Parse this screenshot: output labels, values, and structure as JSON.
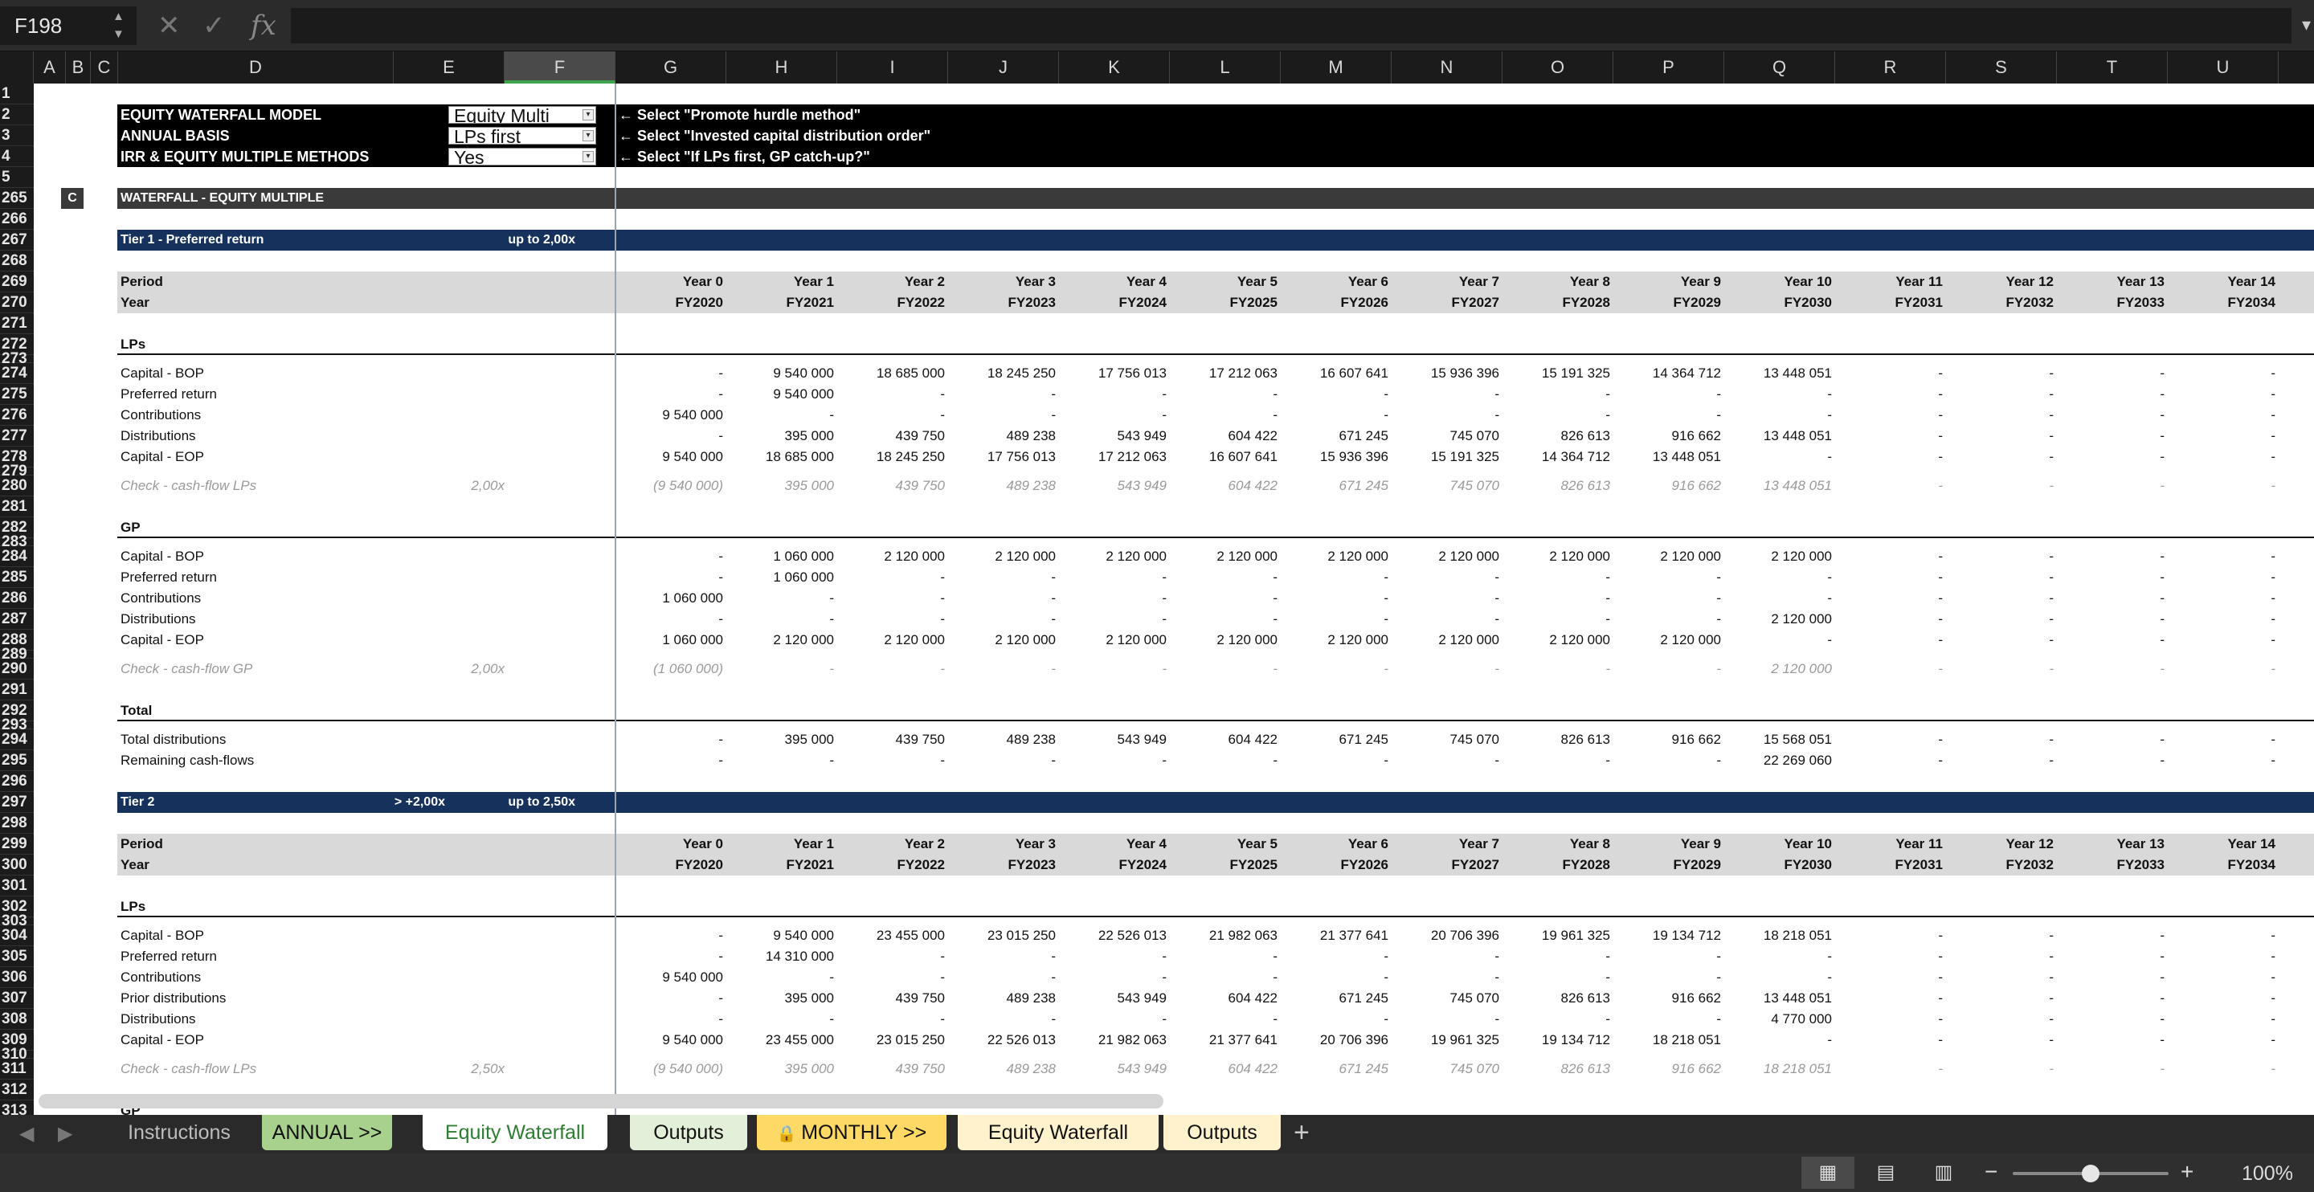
{
  "formula_bar": {
    "name_box": "F198",
    "formula": "",
    "cancel_icon": "close-icon",
    "enter_icon": "checkmark-icon",
    "fx_label": "fx"
  },
  "columns": [
    "A",
    "B",
    "C",
    "D",
    "E",
    "F",
    "G",
    "H",
    "I",
    "J",
    "K",
    "L",
    "M",
    "N",
    "O",
    "P",
    "Q",
    "R",
    "S",
    "T",
    "U"
  ],
  "selected_column": "F",
  "header_block": {
    "r2": {
      "label": "EQUITY WATERFALL MODEL",
      "dropdown": "Equity Multi",
      "note": "← Select \"Promote hurdle method\""
    },
    "r3": {
      "label": "ANNUAL BASIS",
      "dropdown": "LPs first",
      "note": "← Select \"Invested capital distribution order\""
    },
    "r4": {
      "label": "IRR & EQUITY MULTIPLE METHODS",
      "dropdown": "Yes",
      "note": "← Select \"If LPs first, GP catch-up?\""
    }
  },
  "section": {
    "marker": "C",
    "title": "WATERFALL - EQUITY MULTIPLE"
  },
  "tier1": {
    "title": "Tier 1 - Preferred return",
    "hurdle": "up to 2,00x"
  },
  "tier2": {
    "title": "Tier 2",
    "lower": "> +2,00x",
    "hurdle": "up to 2,50x"
  },
  "periods": {
    "period_label": "Period",
    "year_label": "Year",
    "years": [
      "Year 0",
      "Year 1",
      "Year 2",
      "Year 3",
      "Year 4",
      "Year 5",
      "Year 6",
      "Year 7",
      "Year 8",
      "Year 9",
      "Year 10",
      "Year 11",
      "Year 12",
      "Year 13",
      "Year 14"
    ],
    "fiscal": [
      "FY2020",
      "FY2021",
      "FY2022",
      "FY2023",
      "FY2024",
      "FY2025",
      "FY2026",
      "FY2027",
      "FY2028",
      "FY2029",
      "FY2030",
      "FY2031",
      "FY2032",
      "FY2033",
      "FY2034"
    ]
  },
  "t1_lps": {
    "heading": "LPs",
    "rows": [
      {
        "label": "Capital - BOP",
        "values": [
          "-",
          "9 540 000",
          "18 685 000",
          "18 245 250",
          "17 756 013",
          "17 212 063",
          "16 607 641",
          "15 936 396",
          "15 191 325",
          "14 364 712",
          "13 448 051",
          "-",
          "-",
          "-",
          "-"
        ]
      },
      {
        "label": "Preferred return",
        "values": [
          "-",
          "9 540 000",
          "-",
          "-",
          "-",
          "-",
          "-",
          "-",
          "-",
          "-",
          "-",
          "-",
          "-",
          "-",
          "-"
        ]
      },
      {
        "label": "Contributions",
        "values": [
          "9 540 000",
          "-",
          "-",
          "-",
          "-",
          "-",
          "-",
          "-",
          "-",
          "-",
          "-",
          "-",
          "-",
          "-",
          "-"
        ]
      },
      {
        "label": "Distributions",
        "values": [
          "-",
          "395 000",
          "439 750",
          "489 238",
          "543 949",
          "604 422",
          "671 245",
          "745 070",
          "826 613",
          "916 662",
          "13 448 051",
          "-",
          "-",
          "-",
          "-"
        ]
      },
      {
        "label": "Capital - EOP",
        "values": [
          "9 540 000",
          "18 685 000",
          "18 245 250",
          "17 756 013",
          "17 212 063",
          "16 607 641",
          "15 936 396",
          "15 191 325",
          "14 364 712",
          "13 448 051",
          "-",
          "-",
          "-",
          "-",
          "-"
        ]
      }
    ],
    "check": {
      "label": "Check - cash-flow LPs",
      "multiple": "2,00x",
      "values": [
        "(9 540 000)",
        "395 000",
        "439 750",
        "489 238",
        "543 949",
        "604 422",
        "671 245",
        "745 070",
        "826 613",
        "916 662",
        "13 448 051",
        "-",
        "-",
        "-",
        "-"
      ]
    }
  },
  "t1_gp": {
    "heading": "GP",
    "rows": [
      {
        "label": "Capital - BOP",
        "values": [
          "-",
          "1 060 000",
          "2 120 000",
          "2 120 000",
          "2 120 000",
          "2 120 000",
          "2 120 000",
          "2 120 000",
          "2 120 000",
          "2 120 000",
          "2 120 000",
          "-",
          "-",
          "-",
          "-"
        ]
      },
      {
        "label": "Preferred return",
        "values": [
          "-",
          "1 060 000",
          "-",
          "-",
          "-",
          "-",
          "-",
          "-",
          "-",
          "-",
          "-",
          "-",
          "-",
          "-",
          "-"
        ]
      },
      {
        "label": "Contributions",
        "values": [
          "1 060 000",
          "-",
          "-",
          "-",
          "-",
          "-",
          "-",
          "-",
          "-",
          "-",
          "-",
          "-",
          "-",
          "-",
          "-"
        ]
      },
      {
        "label": "Distributions",
        "values": [
          "-",
          "-",
          "-",
          "-",
          "-",
          "-",
          "-",
          "-",
          "-",
          "-",
          "2 120 000",
          "-",
          "-",
          "-",
          "-"
        ]
      },
      {
        "label": "Capital - EOP",
        "values": [
          "1 060 000",
          "2 120 000",
          "2 120 000",
          "2 120 000",
          "2 120 000",
          "2 120 000",
          "2 120 000",
          "2 120 000",
          "2 120 000",
          "2 120 000",
          "-",
          "-",
          "-",
          "-",
          "-"
        ]
      }
    ],
    "check": {
      "label": "Check - cash-flow GP",
      "multiple": "2,00x",
      "values": [
        "(1 060 000)",
        "-",
        "-",
        "-",
        "-",
        "-",
        "-",
        "-",
        "-",
        "-",
        "2 120 000",
        "-",
        "-",
        "-",
        "-"
      ]
    }
  },
  "t1_total": {
    "heading": "Total",
    "rows": [
      {
        "label": "Total distributions",
        "values": [
          "-",
          "395 000",
          "439 750",
          "489 238",
          "543 949",
          "604 422",
          "671 245",
          "745 070",
          "826 613",
          "916 662",
          "15 568 051",
          "-",
          "-",
          "-",
          "-"
        ]
      },
      {
        "label": "Remaining cash-flows",
        "values": [
          "-",
          "-",
          "-",
          "-",
          "-",
          "-",
          "-",
          "-",
          "-",
          "-",
          "22 269 060",
          "-",
          "-",
          "-",
          "-"
        ]
      }
    ]
  },
  "t2_lps": {
    "heading": "LPs",
    "rows": [
      {
        "label": "Capital - BOP",
        "values": [
          "-",
          "9 540 000",
          "23 455 000",
          "23 015 250",
          "22 526 013",
          "21 982 063",
          "21 377 641",
          "20 706 396",
          "19 961 325",
          "19 134 712",
          "18 218 051",
          "-",
          "-",
          "-",
          "-"
        ]
      },
      {
        "label": "Preferred return",
        "values": [
          "-",
          "14 310 000",
          "-",
          "-",
          "-",
          "-",
          "-",
          "-",
          "-",
          "-",
          "-",
          "-",
          "-",
          "-",
          "-"
        ]
      },
      {
        "label": "Contributions",
        "values": [
          "9 540 000",
          "-",
          "-",
          "-",
          "-",
          "-",
          "-",
          "-",
          "-",
          "-",
          "-",
          "-",
          "-",
          "-",
          "-"
        ]
      },
      {
        "label": "Prior distributions",
        "values": [
          "-",
          "395 000",
          "439 750",
          "489 238",
          "543 949",
          "604 422",
          "671 245",
          "745 070",
          "826 613",
          "916 662",
          "13 448 051",
          "-",
          "-",
          "-",
          "-"
        ]
      },
      {
        "label": "Distributions",
        "values": [
          "-",
          "-",
          "-",
          "-",
          "-",
          "-",
          "-",
          "-",
          "-",
          "-",
          "4 770 000",
          "-",
          "-",
          "-",
          "-"
        ]
      },
      {
        "label": "Capital - EOP",
        "values": [
          "9 540 000",
          "23 455 000",
          "23 015 250",
          "22 526 013",
          "21 982 063",
          "21 377 641",
          "20 706 396",
          "19 961 325",
          "19 134 712",
          "18 218 051",
          "-",
          "-",
          "-",
          "-",
          "-"
        ]
      }
    ],
    "check": {
      "label": "Check - cash-flow LPs",
      "multiple": "2,50x",
      "values": [
        "(9 540 000)",
        "395 000",
        "439 750",
        "489 238",
        "543 949",
        "604 422",
        "671 245",
        "745 070",
        "826 613",
        "916 662",
        "18 218 051",
        "-",
        "-",
        "-",
        "-"
      ]
    }
  },
  "t2_gp_partial": "GP",
  "tabs": [
    {
      "label": "Instructions",
      "bg": "#2a2a2a",
      "fg": "#bdbdbd"
    },
    {
      "label": "ANNUAL >>",
      "bg": "#a9d18e",
      "fg": "#111111"
    },
    {
      "label": "Equity Waterfall",
      "bg": "#ffffff",
      "fg": "#2e7d32",
      "active": true
    },
    {
      "label": "Outputs",
      "bg": "#e2efd9",
      "fg": "#111111"
    },
    {
      "label": "MONTHLY >>",
      "bg": "#ffd966",
      "fg": "#111111",
      "locked": true
    },
    {
      "label": "Equity Waterfall",
      "bg": "#fff2cc",
      "fg": "#111111"
    },
    {
      "label": "Outputs",
      "bg": "#fff2cc",
      "fg": "#111111"
    }
  ],
  "status": {
    "zoom": "100%",
    "zoom_fraction": 0.5
  }
}
